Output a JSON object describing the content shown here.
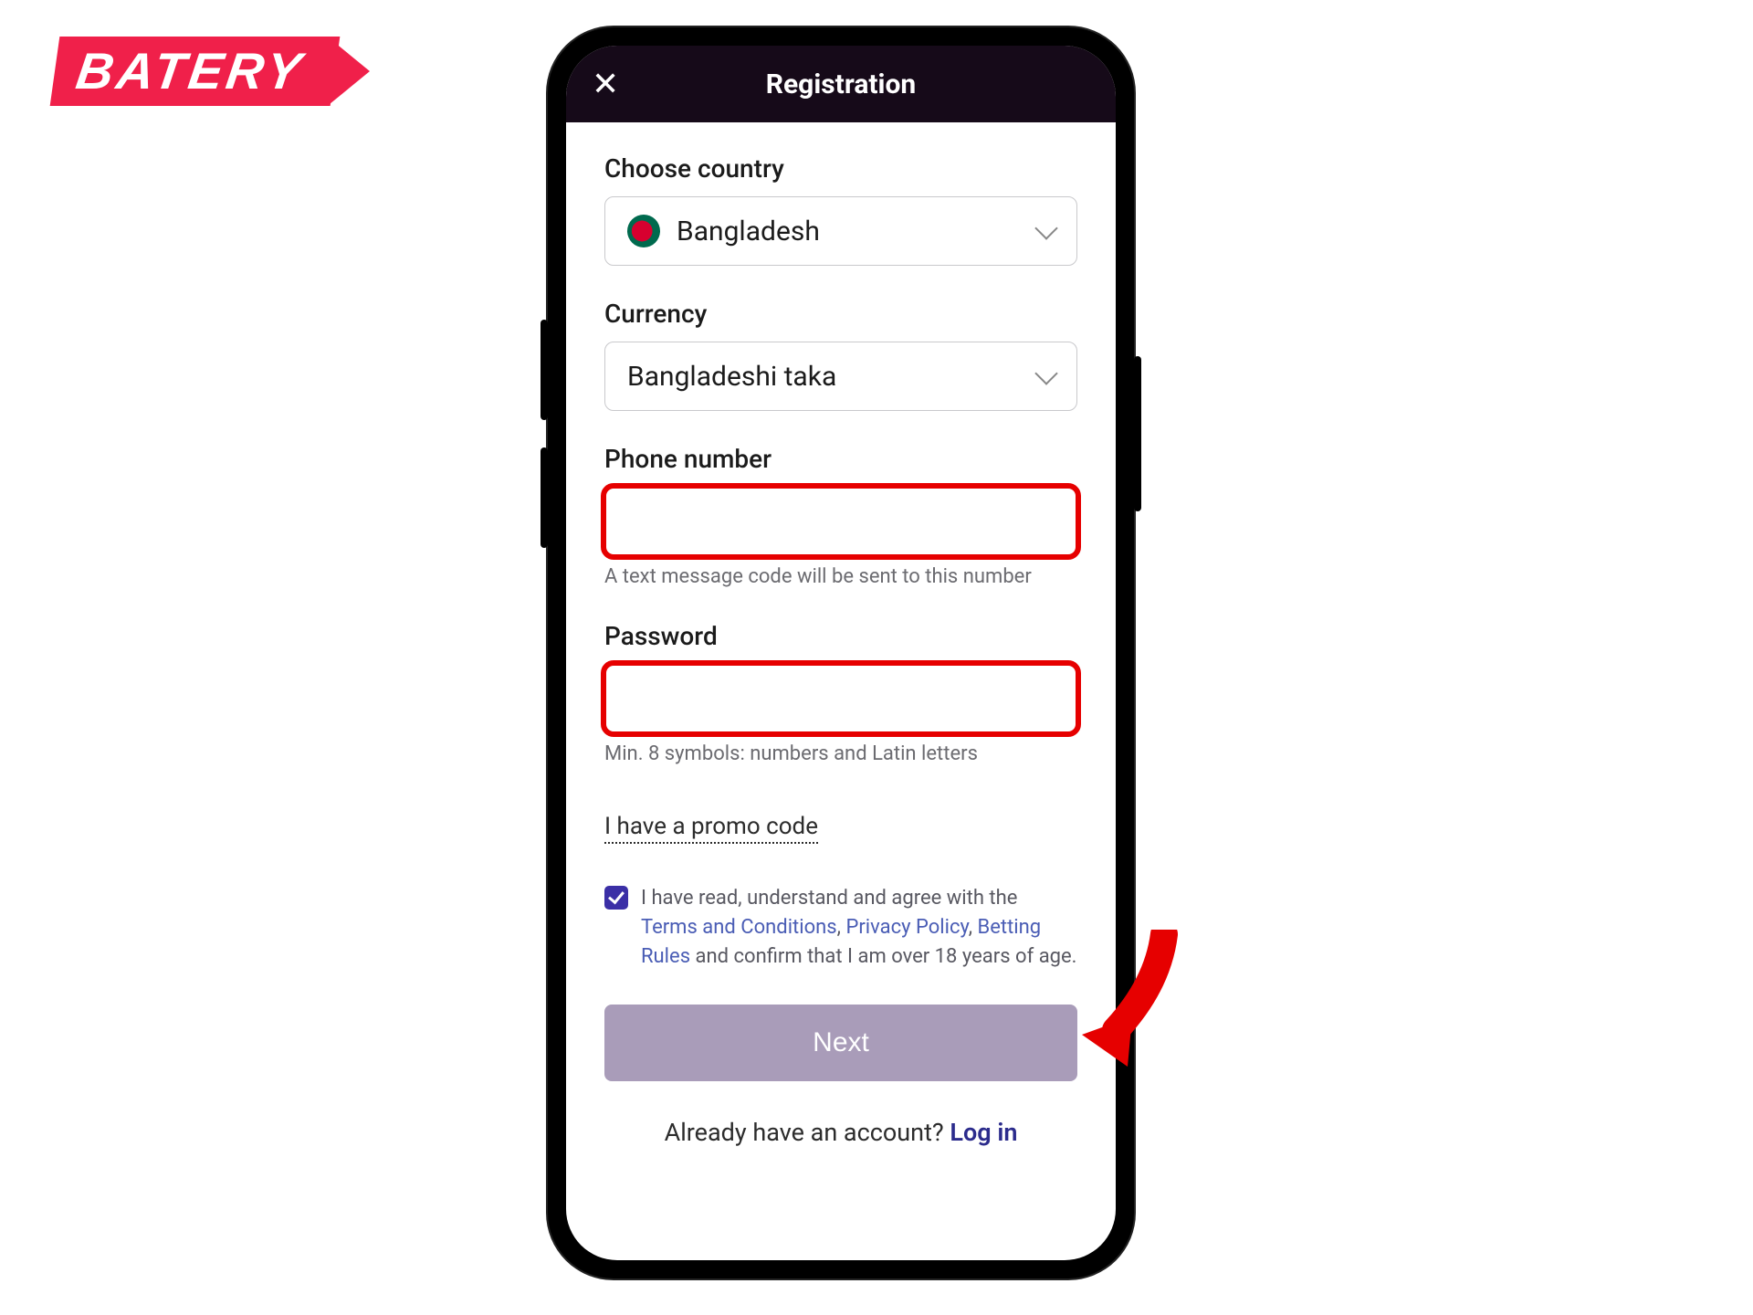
{
  "brand": {
    "name": "BATERY"
  },
  "titlebar": {
    "title": "Registration"
  },
  "country": {
    "label": "Choose country",
    "value": "Bangladesh"
  },
  "currency": {
    "label": "Currency",
    "value": "Bangladeshi taka"
  },
  "phone": {
    "label": "Phone number",
    "value": "",
    "hint": "A text message code will be sent to this number"
  },
  "password": {
    "label": "Password",
    "value": "",
    "hint": "Min. 8 symbols: numbers and Latin letters"
  },
  "promo": {
    "link_text": "I have a promo code"
  },
  "agree": {
    "prefix": "I have read, understand and agree with the ",
    "terms": "Terms and Conditions",
    "sep1": ", ",
    "privacy": "Privacy Policy",
    "sep2": ", ",
    "betting": "Betting Rules",
    "suffix": " and confirm that I am over 18 years of age."
  },
  "next": {
    "label": "Next"
  },
  "footer": {
    "question": "Already have an account? ",
    "login": "Log in"
  }
}
